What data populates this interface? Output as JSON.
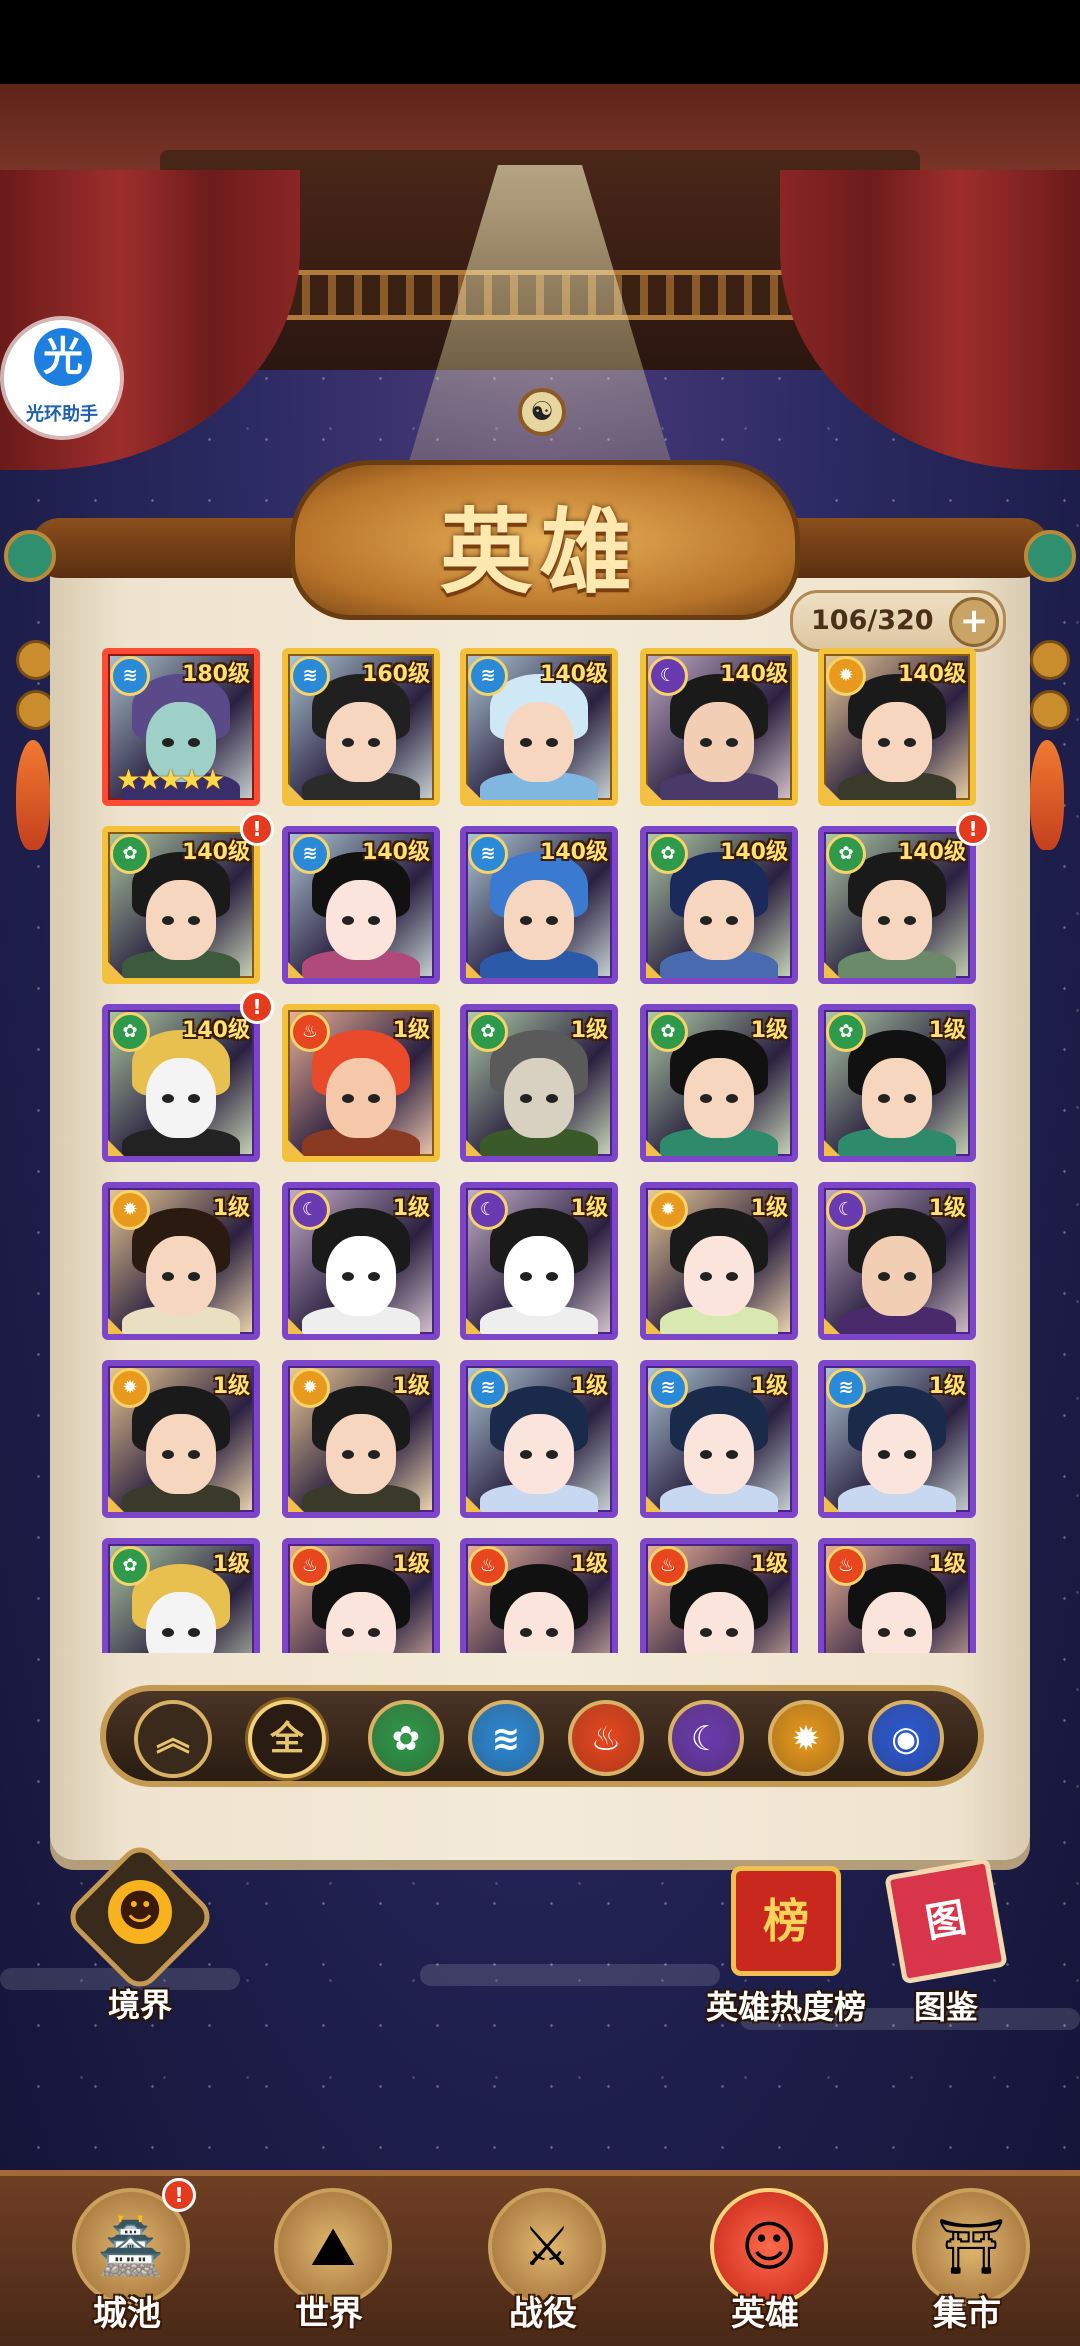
{
  "helper": {
    "glyph": "光",
    "label": "光环助手"
  },
  "header": {
    "title": "英雄",
    "symbol": "☯"
  },
  "roster": {
    "count": "106/320",
    "add": "+"
  },
  "heroes": [
    {
      "level": "180级",
      "element": "water",
      "frame": "red",
      "stars": "★★★★★",
      "alert": false,
      "hair": "#5a4a8a",
      "robe": "#3a2e6a",
      "skin": "#9fd0c8"
    },
    {
      "level": "160级",
      "element": "water",
      "frame": "gold",
      "alert": false,
      "hair": "#202020",
      "robe": "#2b2b2b",
      "skin": "#f6d6bf"
    },
    {
      "level": "140级",
      "element": "water",
      "frame": "gold",
      "alert": false,
      "hair": "#cfe8f5",
      "robe": "#7fb7e0",
      "skin": "#f6d6bf"
    },
    {
      "level": "140级",
      "element": "moon",
      "frame": "gold",
      "alert": false,
      "hair": "#1a1a1a",
      "robe": "#4a3a6a",
      "skin": "#f2cfb4"
    },
    {
      "level": "140级",
      "element": "sun",
      "frame": "gold",
      "alert": false,
      "hair": "#1a1a1a",
      "robe": "#3a3a2a",
      "skin": "#f6d6bf"
    },
    {
      "level": "140级",
      "element": "leaf",
      "frame": "gold",
      "alert": true,
      "hair": "#1a1a1a",
      "robe": "#3e5a3e",
      "skin": "#f6d6bf"
    },
    {
      "level": "140级",
      "element": "water",
      "frame": "purple",
      "alert": false,
      "hair": "#111111",
      "robe": "#b04a7a",
      "skin": "#fbe4dc"
    },
    {
      "level": "140级",
      "element": "water",
      "frame": "purple",
      "alert": false,
      "hair": "#3a7ad0",
      "robe": "#2a5aa8",
      "skin": "#f6d6bf"
    },
    {
      "level": "140级",
      "element": "leaf",
      "frame": "purple",
      "alert": false,
      "hair": "#1a2a5a",
      "robe": "#4a6ab0",
      "skin": "#f6d6bf"
    },
    {
      "level": "140级",
      "element": "leaf",
      "frame": "purple",
      "alert": true,
      "hair": "#1a1a1a",
      "robe": "#6a8a6a",
      "skin": "#f6d6bf"
    },
    {
      "level": "140级",
      "element": "leaf",
      "frame": "purple",
      "alert": true,
      "hair": "#e8c050",
      "robe": "#222222",
      "skin": "#f4f4f4"
    },
    {
      "level": "1级",
      "element": "fire",
      "frame": "gold",
      "alert": false,
      "hair": "#e84a2a",
      "robe": "#8a3a20",
      "skin": "#f4c8a8"
    },
    {
      "level": "1级",
      "element": "leaf",
      "frame": "purple",
      "alert": false,
      "hair": "#5a5a5a",
      "robe": "#3a5a2a",
      "skin": "#d8d0c0"
    },
    {
      "level": "1级",
      "element": "leaf",
      "frame": "purple",
      "alert": false,
      "hair": "#111111",
      "robe": "#2e8a6a",
      "skin": "#f6d6bf"
    },
    {
      "level": "1级",
      "element": "leaf",
      "frame": "purple",
      "alert": false,
      "hair": "#111111",
      "robe": "#2e8a6a",
      "skin": "#f6d6bf"
    },
    {
      "level": "1级",
      "element": "sun",
      "frame": "purple",
      "alert": false,
      "hair": "#2a1a10",
      "robe": "#e8e0c0",
      "skin": "#f6d6bf"
    },
    {
      "level": "1级",
      "element": "moon",
      "frame": "purple",
      "alert": false,
      "hair": "#1a1a1a",
      "robe": "#eeeeee",
      "skin": "#ffffff"
    },
    {
      "level": "1级",
      "element": "moon",
      "frame": "purple",
      "alert": false,
      "hair": "#1a1a1a",
      "robe": "#eeeeee",
      "skin": "#ffffff"
    },
    {
      "level": "1级",
      "element": "sun",
      "frame": "purple",
      "alert": false,
      "hair": "#1a1a1a",
      "robe": "#d8e8b0",
      "skin": "#fbe4dc"
    },
    {
      "level": "1级",
      "element": "moon",
      "frame": "purple",
      "alert": false,
      "hair": "#1a1a1a",
      "robe": "#4a2a6a",
      "skin": "#f2cfb4"
    },
    {
      "level": "1级",
      "element": "sun",
      "frame": "purple",
      "alert": false,
      "hair": "#1a1a1a",
      "robe": "#3a3a2a",
      "skin": "#f6d6bf"
    },
    {
      "level": "1级",
      "element": "sun",
      "frame": "purple",
      "alert": false,
      "hair": "#1a1a1a",
      "robe": "#3a3a2a",
      "skin": "#f6d6bf"
    },
    {
      "level": "1级",
      "element": "water",
      "frame": "purple",
      "alert": false,
      "hair": "#1a2a4a",
      "robe": "#c8d8f0",
      "skin": "#fbe4dc"
    },
    {
      "level": "1级",
      "element": "water",
      "frame": "purple",
      "alert": false,
      "hair": "#1a2a4a",
      "robe": "#c8d8f0",
      "skin": "#fbe4dc"
    },
    {
      "level": "1级",
      "element": "water",
      "frame": "purple",
      "alert": false,
      "hair": "#1a2a4a",
      "robe": "#c8d8f0",
      "skin": "#fbe4dc"
    },
    {
      "level": "1级",
      "element": "leaf",
      "frame": "purple",
      "alert": false,
      "hair": "#e8c050",
      "robe": "#222222",
      "skin": "#f4f4f4"
    },
    {
      "level": "1级",
      "element": "fire",
      "frame": "purple",
      "alert": false,
      "hair": "#111111",
      "robe": "#c02a2a",
      "skin": "#fbe4dc"
    },
    {
      "level": "1级",
      "element": "fire",
      "frame": "purple",
      "alert": false,
      "hair": "#111111",
      "robe": "#c02a2a",
      "skin": "#fbe4dc"
    },
    {
      "level": "1级",
      "element": "fire",
      "frame": "purple",
      "alert": false,
      "hair": "#111111",
      "robe": "#c02a2a",
      "skin": "#fbe4dc"
    },
    {
      "level": "1级",
      "element": "fire",
      "frame": "purple",
      "alert": false,
      "hair": "#111111",
      "robe": "#c02a2a",
      "skin": "#fbe4dc"
    }
  ],
  "elements": {
    "water": {
      "glyph": "≋",
      "color": "#2a8ad8"
    },
    "leaf": {
      "glyph": "✿",
      "color": "#2e9a4a"
    },
    "fire": {
      "glyph": "♨",
      "color": "#e8461e"
    },
    "moon": {
      "glyph": "☾",
      "color": "#6a3ab0"
    },
    "sun": {
      "glyph": "✹",
      "color": "#e89a1e"
    },
    "wind": {
      "glyph": "◉",
      "color": "#2a5ad8"
    }
  },
  "filters": {
    "collapse": "︽",
    "all": "全",
    "items": [
      "leaf",
      "water",
      "fire",
      "moon",
      "sun",
      "wind"
    ]
  },
  "side_buttons": {
    "realm": {
      "label": "境界",
      "icon": "☻"
    },
    "ranking": {
      "label": "英雄热度榜",
      "icon": "榜"
    },
    "codex": {
      "label": "图鉴",
      "icon": "图"
    }
  },
  "nav": [
    {
      "label": "城池",
      "icon": "🏯",
      "alert": true,
      "active": false
    },
    {
      "label": "世界",
      "icon": "⛰",
      "alert": false,
      "active": false
    },
    {
      "label": "战役",
      "icon": "⚔",
      "alert": false,
      "active": false
    },
    {
      "label": "英雄",
      "icon": "☺",
      "alert": false,
      "active": true
    },
    {
      "label": "集市",
      "icon": "⛩",
      "alert": false,
      "active": false
    }
  ]
}
